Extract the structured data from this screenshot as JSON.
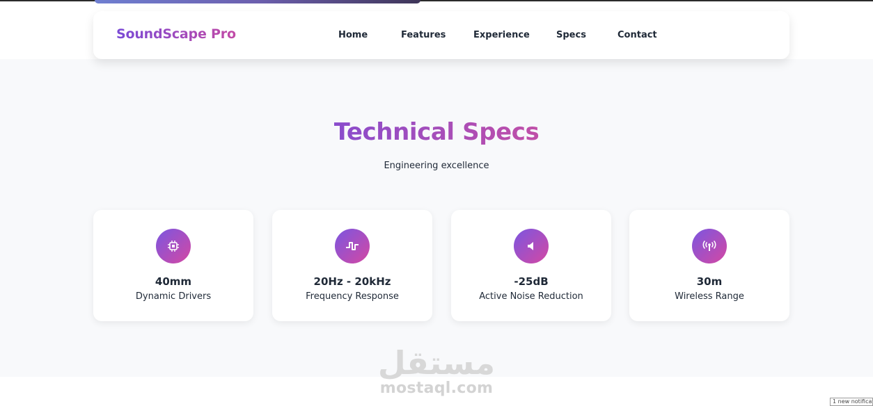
{
  "nav": {
    "brand": "SoundScape Pro",
    "links": [
      "Home",
      "Features",
      "Experience",
      "Specs",
      "Contact"
    ]
  },
  "section": {
    "title": "Technical Specs",
    "subtitle": "Engineering excellence"
  },
  "specs": [
    {
      "icon": "chip-icon",
      "value": "40mm",
      "label": "Dynamic Drivers"
    },
    {
      "icon": "waveform-icon",
      "value": "20Hz - 20kHz",
      "label": "Frequency Response"
    },
    {
      "icon": "speaker-mute-icon",
      "value": "-25dB",
      "label": "Active Noise Reduction"
    },
    {
      "icon": "antenna-icon",
      "value": "30m",
      "label": "Wireless Range"
    }
  ],
  "watermark": {
    "arabic": "مستقل",
    "latin": "mostaql.com"
  },
  "notification": "1 new notification",
  "colors": {
    "gradient_start": "#7b56e0",
    "gradient_end": "#d448a3",
    "title": "#a04dbf",
    "section_bg": "#f8f9fb"
  }
}
